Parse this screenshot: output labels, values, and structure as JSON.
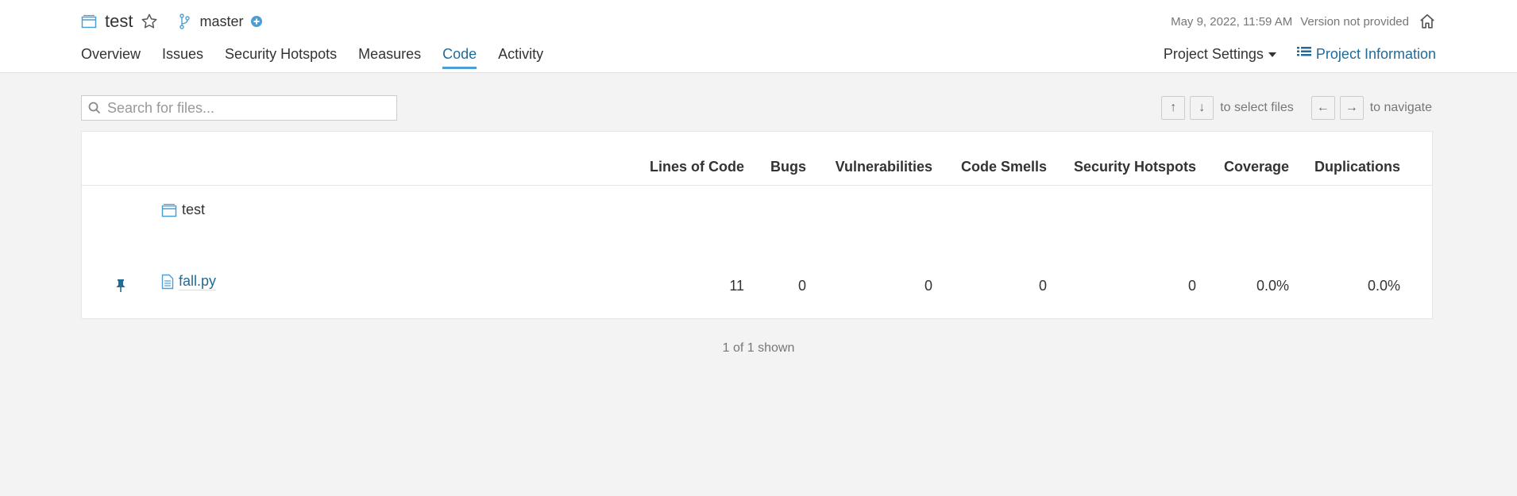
{
  "project": {
    "name": "test",
    "branch": "master"
  },
  "meta": {
    "date": "May 9, 2022, 11:59 AM",
    "version": "Version not provided"
  },
  "tabs": [
    {
      "label": "Overview"
    },
    {
      "label": "Issues"
    },
    {
      "label": "Security Hotspots"
    },
    {
      "label": "Measures"
    },
    {
      "label": "Code",
      "active": true
    },
    {
      "label": "Activity"
    }
  ],
  "right_nav": {
    "settings_label": "Project Settings",
    "info_label": "Project Information"
  },
  "search": {
    "placeholder": "Search for files...",
    "value": ""
  },
  "hints": {
    "select": "to select files",
    "navigate": "to navigate",
    "up": "↑",
    "down": "↓",
    "left": "←",
    "right": "→"
  },
  "table": {
    "columns": [
      "Lines of Code",
      "Bugs",
      "Vulnerabilities",
      "Code Smells",
      "Security Hotspots",
      "Coverage",
      "Duplications"
    ],
    "directory": "test",
    "rows": [
      {
        "name": "fall.py",
        "values": [
          "11",
          "0",
          "0",
          "0",
          "0",
          "0.0%",
          "0.0%"
        ]
      }
    ]
  },
  "footer": {
    "count_text": "1 of 1 shown"
  },
  "colors": {
    "accent": "#4b9fd5",
    "link": "#236a97",
    "background": "#f3f3f3"
  },
  "icons": [
    "project-icon",
    "star-icon",
    "branch-icon",
    "plus-circle-icon",
    "home-icon",
    "list-icon",
    "search-icon",
    "folder-icon",
    "file-icon",
    "pin-icon"
  ]
}
